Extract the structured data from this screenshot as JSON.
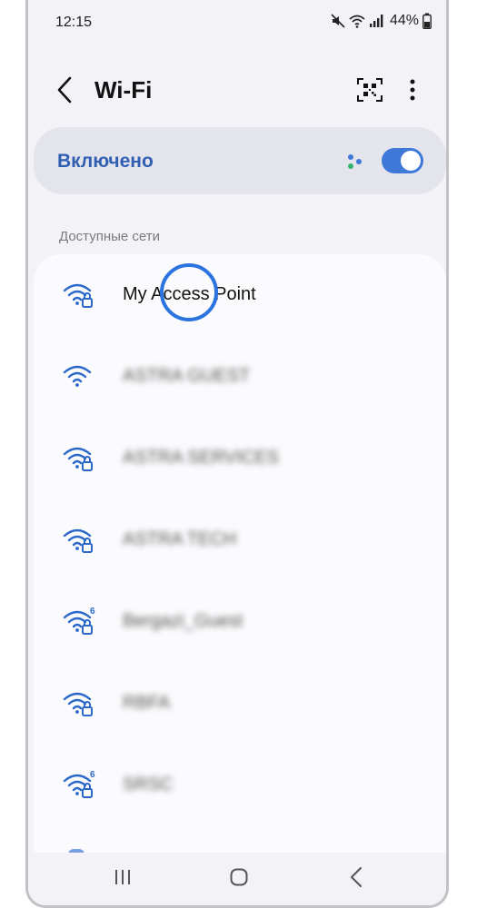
{
  "status_bar": {
    "time": "12:15",
    "battery": "44%"
  },
  "header": {
    "title": "Wi-Fi"
  },
  "toggle": {
    "label": "Включено",
    "state": "on",
    "accent": "#3e78d9"
  },
  "section_title": "Доступные сети",
  "networks": [
    {
      "name": "My Access Point",
      "icon": "wifi-lock-icon",
      "blurred": false
    },
    {
      "name": "ASTRA GUEST",
      "icon": "wifi-icon",
      "blurred": true
    },
    {
      "name": "ASTRA SERVICES",
      "icon": "wifi-lock-icon",
      "blurred": true
    },
    {
      "name": "ASTRA TECH",
      "icon": "wifi-lock-icon",
      "blurred": true
    },
    {
      "name": "Bergazi_Guest",
      "icon": "wifi6-lock-icon",
      "blurred": true
    },
    {
      "name": "RBFA",
      "icon": "wifi-lock-icon",
      "blurred": true
    },
    {
      "name": "SRSC",
      "icon": "wifi6-lock-icon",
      "blurred": true
    }
  ]
}
